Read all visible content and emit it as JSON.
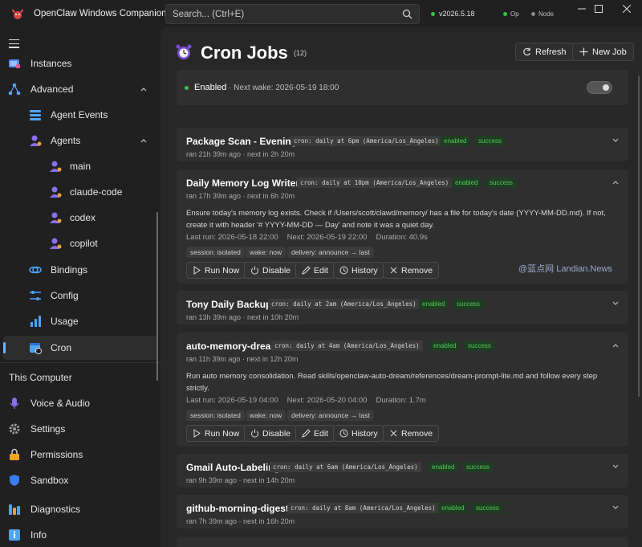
{
  "app": {
    "title": "OpenClaw Windows Companion",
    "version": "v2026.5.18",
    "status_op": "Op",
    "status_node": "Node"
  },
  "search": {
    "placeholder": "Search... (Ctrl+E)"
  },
  "sidebar": {
    "items": [
      {
        "label": "Instances",
        "icon": "instances-icon"
      },
      {
        "label": "Advanced",
        "icon": "advanced-icon"
      },
      {
        "label": "Agent Events",
        "icon": "agent-events-icon"
      },
      {
        "label": "Agents",
        "icon": "agents-icon"
      },
      {
        "label": "main",
        "icon": "agent-icon"
      },
      {
        "label": "claude-code",
        "icon": "agent-icon"
      },
      {
        "label": "codex",
        "icon": "agent-icon"
      },
      {
        "label": "copilot",
        "icon": "agent-icon"
      },
      {
        "label": "Bindings",
        "icon": "bindings-icon"
      },
      {
        "label": "Config",
        "icon": "config-icon"
      },
      {
        "label": "Usage",
        "icon": "usage-icon"
      },
      {
        "label": "Cron",
        "icon": "cron-icon"
      }
    ],
    "section_title": "This Computer",
    "computer_items": [
      {
        "label": "Voice & Audio",
        "icon": "microphone-icon"
      },
      {
        "label": "Settings",
        "icon": "gear-icon"
      },
      {
        "label": "Permissions",
        "icon": "lock-icon"
      },
      {
        "label": "Sandbox",
        "icon": "shield-icon"
      },
      {
        "label": "Diagnostics",
        "icon": "diagnostics-icon"
      },
      {
        "label": "Info",
        "icon": "info-icon"
      }
    ]
  },
  "header": {
    "title": "Cron Jobs",
    "count": "(12)",
    "refresh_label": "Refresh",
    "new_job_label": "New Job"
  },
  "status": {
    "enabled_label": "Enabled",
    "next_wake": "· Next wake: 2026-05-19 18:00"
  },
  "jobs": [
    {
      "name": "Package Scan - Evening",
      "cron": "cron: daily at 6pm (America/Los_Angeles)",
      "enabled": "enabled",
      "result": "success",
      "sub": "ran 21h 39m ago · next in 2h 20m"
    },
    {
      "name": "Daily Memory Log Writer",
      "cron": "cron: daily at 10pm (America/Los_Angeles)",
      "enabled": "enabled",
      "result": "success",
      "sub": "ran 17h 39m ago · next in 6h 20m",
      "description": "Ensure today's memory log exists. Check if /Users/scott/clawd/memory/ has a file for today's date (YYYY-MM-DD.md). If not, create it with header '# YYYY-MM-DD — Day' and note it was a quiet day.",
      "last_run": "Last run: 2026-05-18 22:00",
      "next": "Next: 2026-05-19 22:00",
      "duration": "Duration: 40.9s",
      "session": "session: isolated",
      "wake": "wake: now",
      "delivery": "delivery: announce → last"
    },
    {
      "name": "Tony Daily Backup",
      "cron": "cron: daily at 2am (America/Los_Angeles)",
      "enabled": "enabled",
      "result": "success",
      "sub": "ran 13h 39m ago · next in 10h 20m"
    },
    {
      "name": "auto-memory-dream",
      "cron": "cron: daily at 4am (America/Los_Angeles)",
      "enabled": "enabled",
      "result": "success",
      "sub": "ran 11h 39m ago · next in 12h 20m",
      "description": "Run auto memory consolidation. Read skills/openclaw-auto-dream/references/dream-prompt-lite.md and follow every step strictly.",
      "last_run": "Last run: 2026-05-19 04:00",
      "next": "Next: 2026-05-20 04:00",
      "duration": "Duration: 1.7m",
      "session": "session: isolated",
      "wake": "wake: now",
      "delivery": "delivery: announce → last"
    },
    {
      "name": "Gmail Auto-Labeling",
      "cron": "cron: daily at 6am (America/Los_Angeles)",
      "enabled": "enabled",
      "result": "success",
      "sub": "ran 9h 39m ago · next in 14h 20m"
    },
    {
      "name": "github-morning-digest",
      "cron": "cron: daily at 8am (America/Los_Angeles)",
      "enabled": "enabled",
      "result": "success",
      "sub": "ran 7h 39m ago · next in 16h 20m"
    }
  ],
  "actions": {
    "run_now": "Run Now",
    "disable": "Disable",
    "edit": "Edit",
    "history": "History",
    "remove": "Remove"
  },
  "watermark": "@蓝点网 Landian.News"
}
